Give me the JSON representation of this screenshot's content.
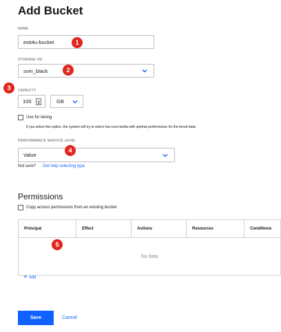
{
  "page_title": "Add Bucket",
  "name": {
    "label": "NAME",
    "value": "esit4u-bucket"
  },
  "storage_vm": {
    "label": "STORAGE VM",
    "value": "svm_black"
  },
  "capacity": {
    "label": "CAPACITY",
    "value": "100",
    "unit": "GB"
  },
  "tiering": {
    "label": "Use for tiering",
    "help": "If you select this option, the system will try to select low-cost media with optimal performance for the tiered data."
  },
  "performance": {
    "label": "PERFORMANCE SERVICE LEVEL",
    "value": "Value",
    "not_sure": "Not sure?",
    "help_link": "Get help selecting type"
  },
  "permissions": {
    "title": "Permissions",
    "copy_label": "Copy access permissions from an existing bucket",
    "columns": [
      "Principal",
      "Effect",
      "Actions",
      "Resources",
      "Conditions"
    ],
    "empty": "No data",
    "add_label": "Add"
  },
  "footer": {
    "save": "Save",
    "cancel": "Cancel"
  },
  "callouts": [
    "1",
    "2",
    "3",
    "4",
    "5"
  ],
  "colors": {
    "accent": "#0f62fe",
    "callout": "#e0261e"
  }
}
